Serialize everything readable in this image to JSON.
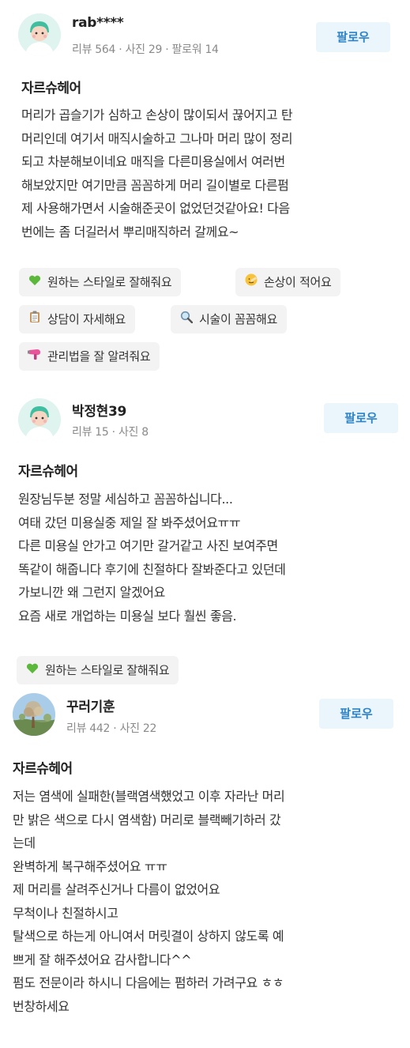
{
  "reviews": [
    {
      "user": "rab****",
      "meta": "리뷰 564 · 사진 29 · 팔로워 14",
      "follow": "팔로우",
      "shop": "자르슈헤어",
      "lines": [
        "머리가 곱슬기가 심하고 손상이 많이되서 끊어지고 탄",
        "머리인데 여기서 매직시술하고 그나마 머리 많이 정리",
        "되고 차분해보이네요 매직을 다른미용실에서 여러번",
        "해보았지만 여기만큼 꼼꼼하게 머리 길이별로 다른펌",
        "제 사용해가면서 시술해준곳이 없었던것같아요! 다음",
        "번에는 좀 더길러서 뿌리매직하러 갈께요~"
      ],
      "tags": [
        {
          "icon": "green-heart-icon",
          "label": "원하는 스타일로 잘해줘요"
        },
        {
          "icon": "bandage-face-icon",
          "label": "손상이 적어요"
        },
        {
          "icon": "clipboard-icon",
          "label": "상담이 자세해요"
        },
        {
          "icon": "magnifier-icon",
          "label": "시술이 꼼꼼해요"
        },
        {
          "icon": "hair-dryer-icon",
          "label": "관리법을 잘 알려줘요"
        }
      ]
    },
    {
      "user": "박정현39",
      "meta": "리뷰 15 · 사진 8",
      "follow": "팔로우",
      "shop": "자르슈헤어",
      "lines": [
        "원장님두분 정말 세심하고 꼼꼼하십니다...",
        "여태 갔던 미용실중 제일 잘 봐주셨어요ㅠㅠ",
        "다른 미용실 안가고 여기만 갈거같고 사진 보여주면",
        "똑같이 해줍니다 후기에 친절하다 잘봐준다고 있던데",
        "가보니깐 왜 그런지 알겠어요",
        "요즘 새로 개업하는 미용실 보다 훨씬 좋음."
      ],
      "tags": [
        {
          "icon": "green-heart-icon",
          "label": "원하는 스타일로 잘해줘요"
        }
      ]
    },
    {
      "user": "꾸러기훈",
      "meta": "리뷰 442 · 사진 22",
      "follow": "팔로우",
      "shop": "자르슈헤어",
      "lines": [
        "저는 염색에 실패한(블랙염색했었고 이후 자라난 머리",
        "만 밝은 색으로 다시 염색함) 머리로 블랙빼기하러 갔",
        "는데",
        "완벽하게 복구해주셨어요 ㅠㅠ",
        "제 머리를 살려주신거나 다름이 없었어요",
        "무척이나 친절하시고",
        "탈색으로 하는게 아니여서 머릿결이 상하지 않도록 예",
        "쁘게 잘 해주셨어요 감사합니다^^",
        "펌도 전문이라 하시니 다음에는 펌하러 가려구요 ㅎㅎ",
        "번창하세요"
      ],
      "tags": []
    }
  ]
}
